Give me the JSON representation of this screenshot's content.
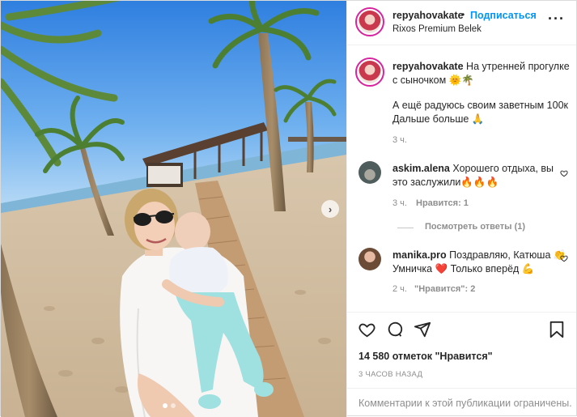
{
  "post": {
    "username": "repyahovakate",
    "follow_label": "Подписаться",
    "location": "Rixos Premium Belek",
    "more_icon": "more-dots-icon"
  },
  "caption": {
    "username": "repyahovakate",
    "line1": "На утренней прогулке с сыночком 🌞🌴",
    "line2": "А ещё радуюсь своим заветным 100к Дальше больше 🙏",
    "time": "3 ч."
  },
  "comments": [
    {
      "username": "askim.alena",
      "text": "Хорошего отдыха, вы это заслужили🔥🔥🔥",
      "time": "3 ч.",
      "likes": "Нравится: 1"
    },
    {
      "username": "manika.pro",
      "text": "Поздравляю, Катюша 👏Умничка ❤️ Только вперёд 💪",
      "time": "2 ч.",
      "likes": "\"Нравится\": 2"
    }
  ],
  "view_replies": "Посмотреть ответы (1)",
  "likes_count": "14 580 отметок \"Нравится\"",
  "posted_ago": "3 ЧАСОВ НАЗАД",
  "comments_limited": "Комментарии к этой публикации ограничены.",
  "carousel": {
    "current": 1,
    "total": 2
  },
  "colors": {
    "link": "#0095f6",
    "muted": "#8e8e8e",
    "text": "#262626"
  }
}
